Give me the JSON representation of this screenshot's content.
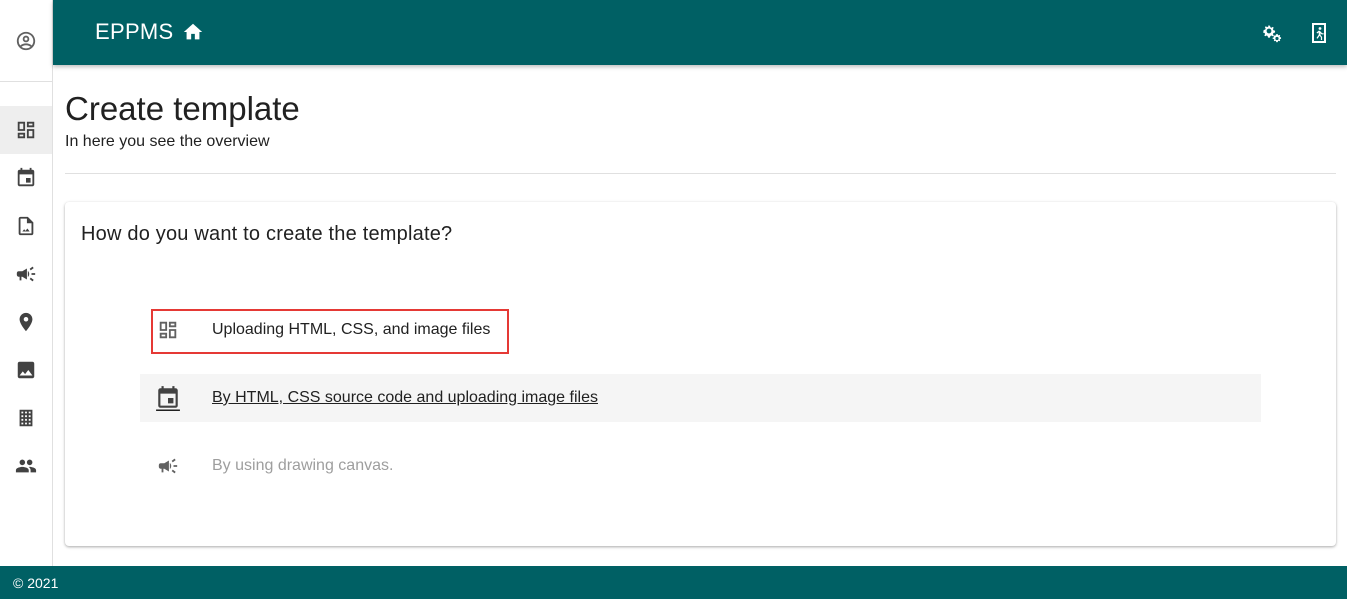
{
  "app": {
    "brand": "EPPMS",
    "accent_color": "#006064"
  },
  "rail": {
    "avatar_icon": "account-circle-icon",
    "items": [
      {
        "icon": "dashboard-icon",
        "active": true
      },
      {
        "icon": "event-icon",
        "active": false
      },
      {
        "icon": "image-file-icon",
        "active": false
      },
      {
        "icon": "campaign-icon",
        "active": false
      },
      {
        "icon": "place-icon",
        "active": false
      },
      {
        "icon": "image-icon",
        "active": false
      },
      {
        "icon": "building-icon",
        "active": false
      },
      {
        "icon": "people-icon",
        "active": false
      }
    ]
  },
  "appbar": {
    "settings_icon": "settings-gears-icon",
    "logout_icon": "exit-door-icon"
  },
  "page": {
    "title": "Create template",
    "subtitle": "In here you see the overview"
  },
  "card": {
    "title": "How do you want to create the template?",
    "options": [
      {
        "label": "Uploading HTML, CSS, and image files",
        "icon": "dashboard-icon",
        "state": "highlighted"
      },
      {
        "label": "By HTML, CSS source code and uploading image files",
        "icon": "event-icon",
        "state": "hover"
      },
      {
        "label": "By using drawing canvas.",
        "icon": "campaign-icon",
        "state": "disabled"
      }
    ]
  },
  "footer": {
    "text": "© 2021"
  }
}
